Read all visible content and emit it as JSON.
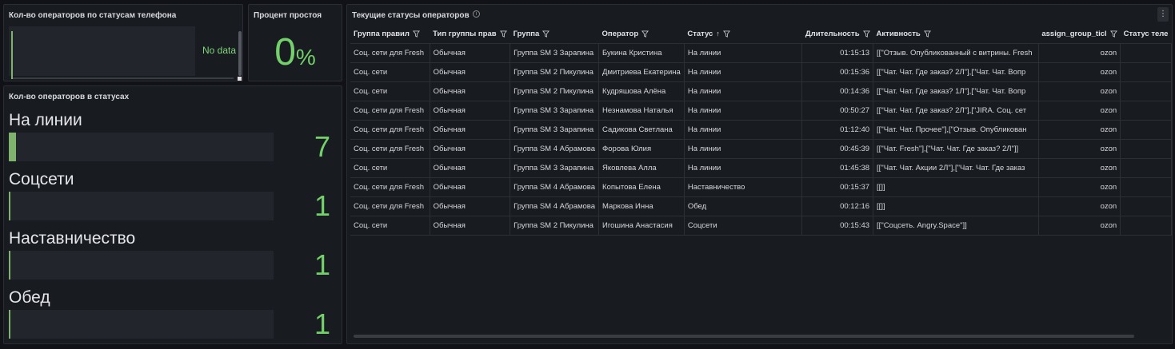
{
  "panels": {
    "phone": {
      "title": "Кол-во операторов по статусам телефона",
      "no_data": "No data"
    },
    "idle": {
      "title": "Процент простоя",
      "value": "0",
      "unit": "%"
    },
    "status_counts": {
      "title": "Кол-во операторов в статусах",
      "items": [
        {
          "label": "На линии",
          "value": "7",
          "fill": 1.0
        },
        {
          "label": "Соцсети",
          "value": "1",
          "fill": 0.14
        },
        {
          "label": "Наставничество",
          "value": "1",
          "fill": 0.14
        },
        {
          "label": "Обед",
          "value": "1",
          "fill": 0.14
        }
      ]
    },
    "table": {
      "title": "Текущие статусы операторов",
      "columns": [
        "Группа правил",
        "Тип группы прав",
        "Группа",
        "Оператор",
        "Статус",
        "Длительность",
        "Активность",
        "assign_group_ticl",
        "Статус теле"
      ],
      "rows": [
        [
          "Соц. сети для Fresh",
          "Обычная",
          "Группа SM 3 Зарапина",
          "Букина Кристина",
          "На линии",
          "01:15:13",
          "[[\"Отзыв. Опубликованный с витрины. Fresh",
          "ozon",
          ""
        ],
        [
          "Соц. сети",
          "Обычная",
          "Группа SM 2 Пикулина",
          "Дмитриева Екатерина",
          "На линии",
          "00:15:36",
          "[[\"Чат. Чат. Где заказ? 2Л\"],[\"Чат. Чат. Вопр",
          "ozon",
          ""
        ],
        [
          "Соц. сети",
          "Обычная",
          "Группа SM 2 Пикулина",
          "Кудряшова Алёна",
          "На линии",
          "00:14:36",
          "[[\"Чат. Чат. Где заказ? 1Л\"],[\"Чат. Чат. Вопр",
          "ozon",
          ""
        ],
        [
          "Соц. сети для Fresh",
          "Обычная",
          "Группа SM 3 Зарапина",
          "Незнамова Наталья",
          "На линии",
          "00:50:27",
          "[[\"Чат. Чат. Где заказ? 2Л\"],[\"JIRA. Соц. сет",
          "ozon",
          ""
        ],
        [
          "Соц. сети для Fresh",
          "Обычная",
          "Группа SM 3 Зарапина",
          "Садикова Светлана",
          "На линии",
          "01:12:40",
          "[[\"Чат. Чат. Прочее\"],[\"Отзыв. Опубликован",
          "ozon",
          ""
        ],
        [
          "Соц. сети для Fresh",
          "Обычная",
          "Группа SM 4 Абрамова",
          "Форова Юлия",
          "На линии",
          "00:45:39",
          "[[\"Чат. Fresh\"],[\"Чат. Чат. Где заказ? 2Л\"]]",
          "ozon",
          ""
        ],
        [
          "Соц. сети",
          "Обычная",
          "Группа SM 3 Зарапина",
          "Яковлева Алла",
          "На линии",
          "01:45:38",
          "[[\"Чат. Чат. Акции 2Л\"],[\"Чат. Чат. Где заказ",
          "ozon",
          ""
        ],
        [
          "Соц. сети для Fresh",
          "Обычная",
          "Группа SM 4 Абрамова",
          "Копытова Елена",
          "Наставничество",
          "00:15:37",
          "[[]]",
          "ozon",
          ""
        ],
        [
          "Соц. сети для Fresh",
          "Обычная",
          "Группа SM 4 Абрамова",
          "Маркова Инна",
          "Обед",
          "00:12:16",
          "[[]]",
          "ozon",
          ""
        ],
        [
          "Соц. сети",
          "Обычная",
          "Группа SM 2 Пикулина",
          "Игошина Анастасия",
          "Соцсети",
          "00:15:43",
          "[[\"Соцсеть. Angry.Space\"]]",
          "ozon",
          ""
        ]
      ]
    }
  },
  "colors": {
    "accent_green": "#73d06a",
    "bar_green": "#7eb26d",
    "background": "#111217",
    "panel": "#181b1f"
  }
}
